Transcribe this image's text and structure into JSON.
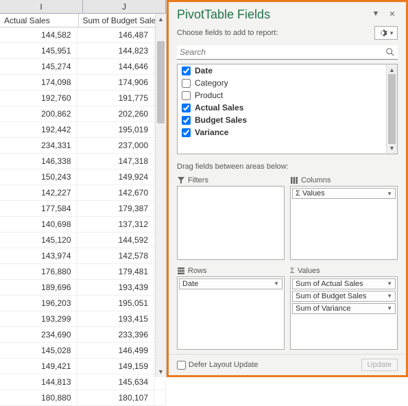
{
  "sheet": {
    "col_letters": [
      "I",
      "J"
    ],
    "headers": [
      "Actual Sales",
      "Sum of Budget Sales"
    ],
    "header_stub": "S",
    "rows": [
      [
        "144,582",
        "146,487"
      ],
      [
        "145,951",
        "144,823"
      ],
      [
        "145,274",
        "144,646"
      ],
      [
        "174,098",
        "174,906"
      ],
      [
        "192,760",
        "191,775"
      ],
      [
        "200,862",
        "202,260"
      ],
      [
        "192,442",
        "195,019"
      ],
      [
        "234,331",
        "237,000"
      ],
      [
        "146,338",
        "147,318"
      ],
      [
        "150,243",
        "149,924"
      ],
      [
        "142,227",
        "142,670"
      ],
      [
        "177,584",
        "179,387"
      ],
      [
        "140,698",
        "137,312"
      ],
      [
        "145,120",
        "144,592"
      ],
      [
        "143,974",
        "142,578"
      ],
      [
        "176,880",
        "179,481"
      ],
      [
        "189,696",
        "193,439"
      ],
      [
        "196,203",
        "195,051"
      ],
      [
        "193,299",
        "193,415"
      ],
      [
        "234,690",
        "233,396"
      ],
      [
        "145,028",
        "146,499"
      ],
      [
        "149,421",
        "149,159"
      ],
      [
        "144,813",
        "145,634"
      ],
      [
        "180,880",
        "180,107"
      ]
    ]
  },
  "panel": {
    "title": "PivotTable Fields",
    "subtitle": "Choose fields to add to report:",
    "search_placeholder": "Search",
    "fields": [
      {
        "label": "Date",
        "checked": true
      },
      {
        "label": "Category",
        "checked": false
      },
      {
        "label": "Product",
        "checked": false
      },
      {
        "label": "Actual Sales",
        "checked": true
      },
      {
        "label": "Budget Sales",
        "checked": true
      },
      {
        "label": "Variance",
        "checked": true
      }
    ],
    "areas_caption": "Drag fields between areas below:",
    "filters_label": "Filters",
    "columns_label": "Columns",
    "rows_label": "Rows",
    "values_label": "Values",
    "columns_items": [
      "Σ Values"
    ],
    "rows_items": [
      "Date"
    ],
    "values_items": [
      "Sum of Actual Sales",
      "Sum of Budget Sales",
      "Sum of Variance"
    ],
    "defer_label": "Defer Layout Update",
    "update_label": "Update"
  }
}
